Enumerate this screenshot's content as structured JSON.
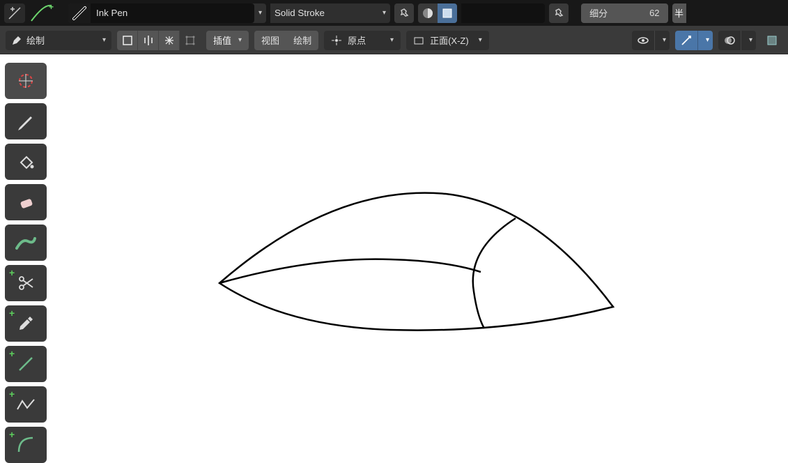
{
  "bar1": {
    "brush_name": "Ink Pen",
    "stroke_style": "Solid Stroke",
    "subdivide_label": "细分",
    "subdivide_value": "62",
    "cut_label": "半"
  },
  "bar2": {
    "mode_label": "绘制",
    "interp_label": "插值",
    "view_label": "视图",
    "draw_label": "绘制",
    "origin_label": "原点",
    "front_label": "正面(X-Z)"
  },
  "tools": {
    "cursor": "cursor-tool",
    "draw": "draw-tool",
    "fill": "fill-tool",
    "erase": "erase-tool",
    "tint": "tint-tool",
    "cutter": "cutter-tool",
    "eyedropper": "eyedropper-tool",
    "line": "line-tool",
    "polyline": "polyline-tool",
    "arc": "arc-tool"
  }
}
